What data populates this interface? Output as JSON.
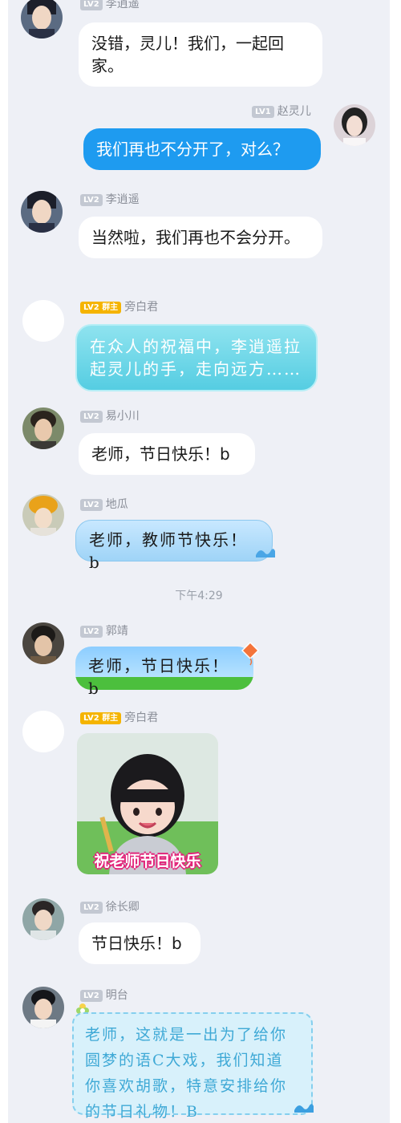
{
  "chat": {
    "timestamp": "下午4:29",
    "messages": [
      {
        "level": "LV2",
        "name": "李逍遥",
        "text": "没错，灵儿！我们，一起回家。"
      },
      {
        "level": "LV1",
        "name": "赵灵儿",
        "text": "我们再也不分开了，对么？"
      },
      {
        "level": "LV2",
        "name": "李逍遥",
        "text": "当然啦，我们再也不会分开。"
      },
      {
        "level": "LV2",
        "role": "群主",
        "name": "旁白君",
        "text": "在众人的祝福中，李逍遥拉起灵儿的手，走向远方……"
      },
      {
        "level": "LV2",
        "name": "易小川",
        "text": "老师，节日快乐！b"
      },
      {
        "level": "LV2",
        "name": "地瓜",
        "text": "老师，教师节快乐！b"
      },
      {
        "level": "LV2",
        "name": "郭靖",
        "text": "老师，节日快乐！b"
      },
      {
        "level": "LV2",
        "role": "群主",
        "name": "旁白君",
        "sticker_caption": "祝老师节日快乐"
      },
      {
        "level": "LV2",
        "name": "徐长卿",
        "text": "节日快乐！b"
      },
      {
        "level": "LV2",
        "name": "明台",
        "text": "老师，这就是一出为了给你圆梦的语C大戏，我们知道你喜欢胡歌，特意安排给你的节日礼物！B"
      }
    ]
  },
  "icons": {
    "avatar": "avatar-photo",
    "decoration_wave": "wave-icon",
    "decoration_kite": "kite-icon",
    "decoration_flower": "flower-icon"
  },
  "colors": {
    "background": "#eef0f6",
    "my_bubble": "#1e9bf0",
    "level_badge": "#c3c8d2",
    "owner_badge": "#f5b400"
  }
}
